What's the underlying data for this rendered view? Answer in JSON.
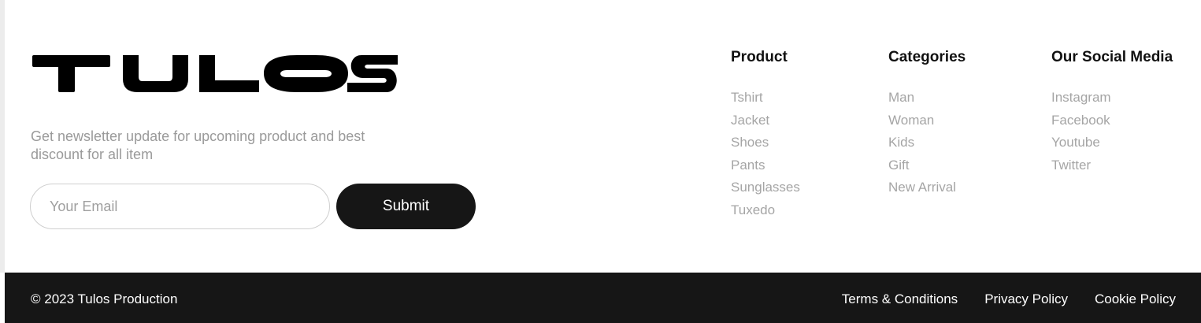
{
  "brand": {
    "logo_text": "TULOS"
  },
  "newsletter": {
    "text": "Get newsletter update for upcoming product and best discount for all item",
    "email_placeholder": "Your Email",
    "email_value": "",
    "submit_label": "Submit"
  },
  "columns": {
    "product": {
      "title": "Product",
      "items": [
        "Tshirt",
        "Jacket",
        "Shoes",
        "Pants",
        "Sunglasses",
        "Tuxedo"
      ]
    },
    "categories": {
      "title": "Categories",
      "items": [
        "Man",
        "Woman",
        "Kids",
        "Gift",
        "New Arrival"
      ]
    },
    "social": {
      "title": "Our Social Media",
      "items": [
        "Instagram",
        "Facebook",
        "Youtube",
        "Twitter"
      ]
    }
  },
  "bottom_bar": {
    "copyright": "© 2023 Tulos Production",
    "links": [
      "Terms & Conditions",
      "Privacy Policy",
      "Cookie Policy"
    ]
  },
  "colors": {
    "background": "#ffffff",
    "footer_bar": "#161616",
    "heading_text": "#111111",
    "muted_text": "#a5a5a5",
    "button_bg": "#161616",
    "button_text": "#ffffff"
  }
}
